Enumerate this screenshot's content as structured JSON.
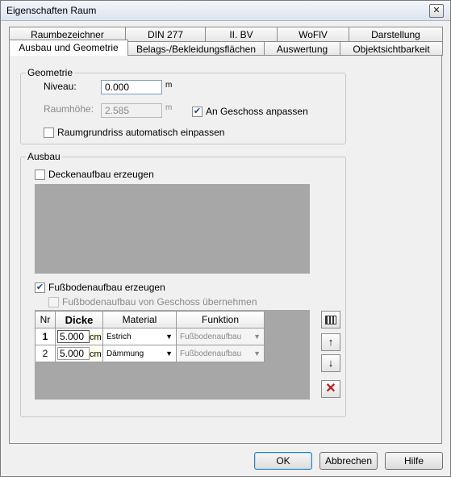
{
  "window": {
    "title": "Eigenschaften Raum",
    "close_glyph": "✕"
  },
  "tabs_row1": [
    "Raumbezeichner",
    "DIN 277",
    "II. BV",
    "WoFlV",
    "Darstellung"
  ],
  "tabs_row2": [
    "Ausbau und Geometrie",
    "Belags-/Bekleidungsflächen",
    "Auswertung",
    "Objektsichtbarkeit"
  ],
  "geometrie": {
    "legend": "Geometrie",
    "niveau_label": "Niveau:",
    "niveau_value": "0.000",
    "niveau_unit": "m",
    "raumhoehe_label": "Raumhöhe:",
    "raumhoehe_value": "2.585",
    "raumhoehe_unit": "m",
    "an_geschoss_label": "An Geschoss anpassen",
    "an_geschoss_checked": true,
    "raumgrundriss_label": "Raumgrundriss automatisch einpassen",
    "raumgrundriss_checked": false
  },
  "ausbau": {
    "legend": "Ausbau",
    "decken_label": "Deckenaufbau erzeugen",
    "decken_checked": false,
    "fussboden_label": "Fußbodenaufbau erzeugen",
    "fussboden_checked": true,
    "fussboden_geschoss_label": "Fußbodenaufbau von Geschoss übernehmen",
    "fussboden_geschoss_checked": false
  },
  "table": {
    "headers": [
      "Nr",
      "Dicke",
      "Material",
      "Funktion"
    ],
    "rows": [
      {
        "nr": "1",
        "dicke": "5.000",
        "unit": "cm",
        "material": "Estrich",
        "funktion": "Fußbodenaufbau"
      },
      {
        "nr": "2",
        "dicke": "5.000",
        "unit": "cm",
        "material": "Dämmung",
        "funktion": "Fußbodenaufbau"
      }
    ]
  },
  "side_buttons": {
    "up": "↑",
    "down": "↓",
    "delete": "✕"
  },
  "buttons": {
    "ok": "OK",
    "cancel": "Abbrechen",
    "help": "Hilfe"
  },
  "colors": {
    "accent_check": "#1c3f8f",
    "delete_red": "#c11616",
    "default_button_border": "#3c7fb1"
  }
}
